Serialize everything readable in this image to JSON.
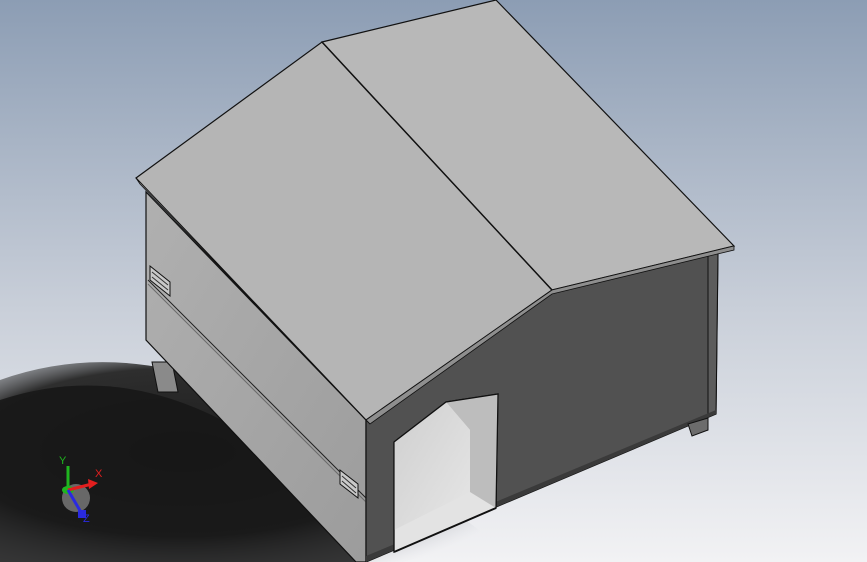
{
  "viewport": {
    "background_top": "#8c9db4",
    "background_bottom": "#f2f2f4",
    "shadow_color": "#1c1c1c"
  },
  "model": {
    "roof_color": "#b5b5b5",
    "side_wall_color": "#a7a7a7",
    "front_wall_color": "#515151",
    "opening_inside_color": "#d6d6d6",
    "edge_color": "#111111"
  },
  "triad": {
    "x_label": "X",
    "y_label": "Y",
    "z_label": "Z",
    "x_color": "#e21e1e",
    "y_color": "#1fb51f",
    "z_color": "#2a2ae0"
  }
}
